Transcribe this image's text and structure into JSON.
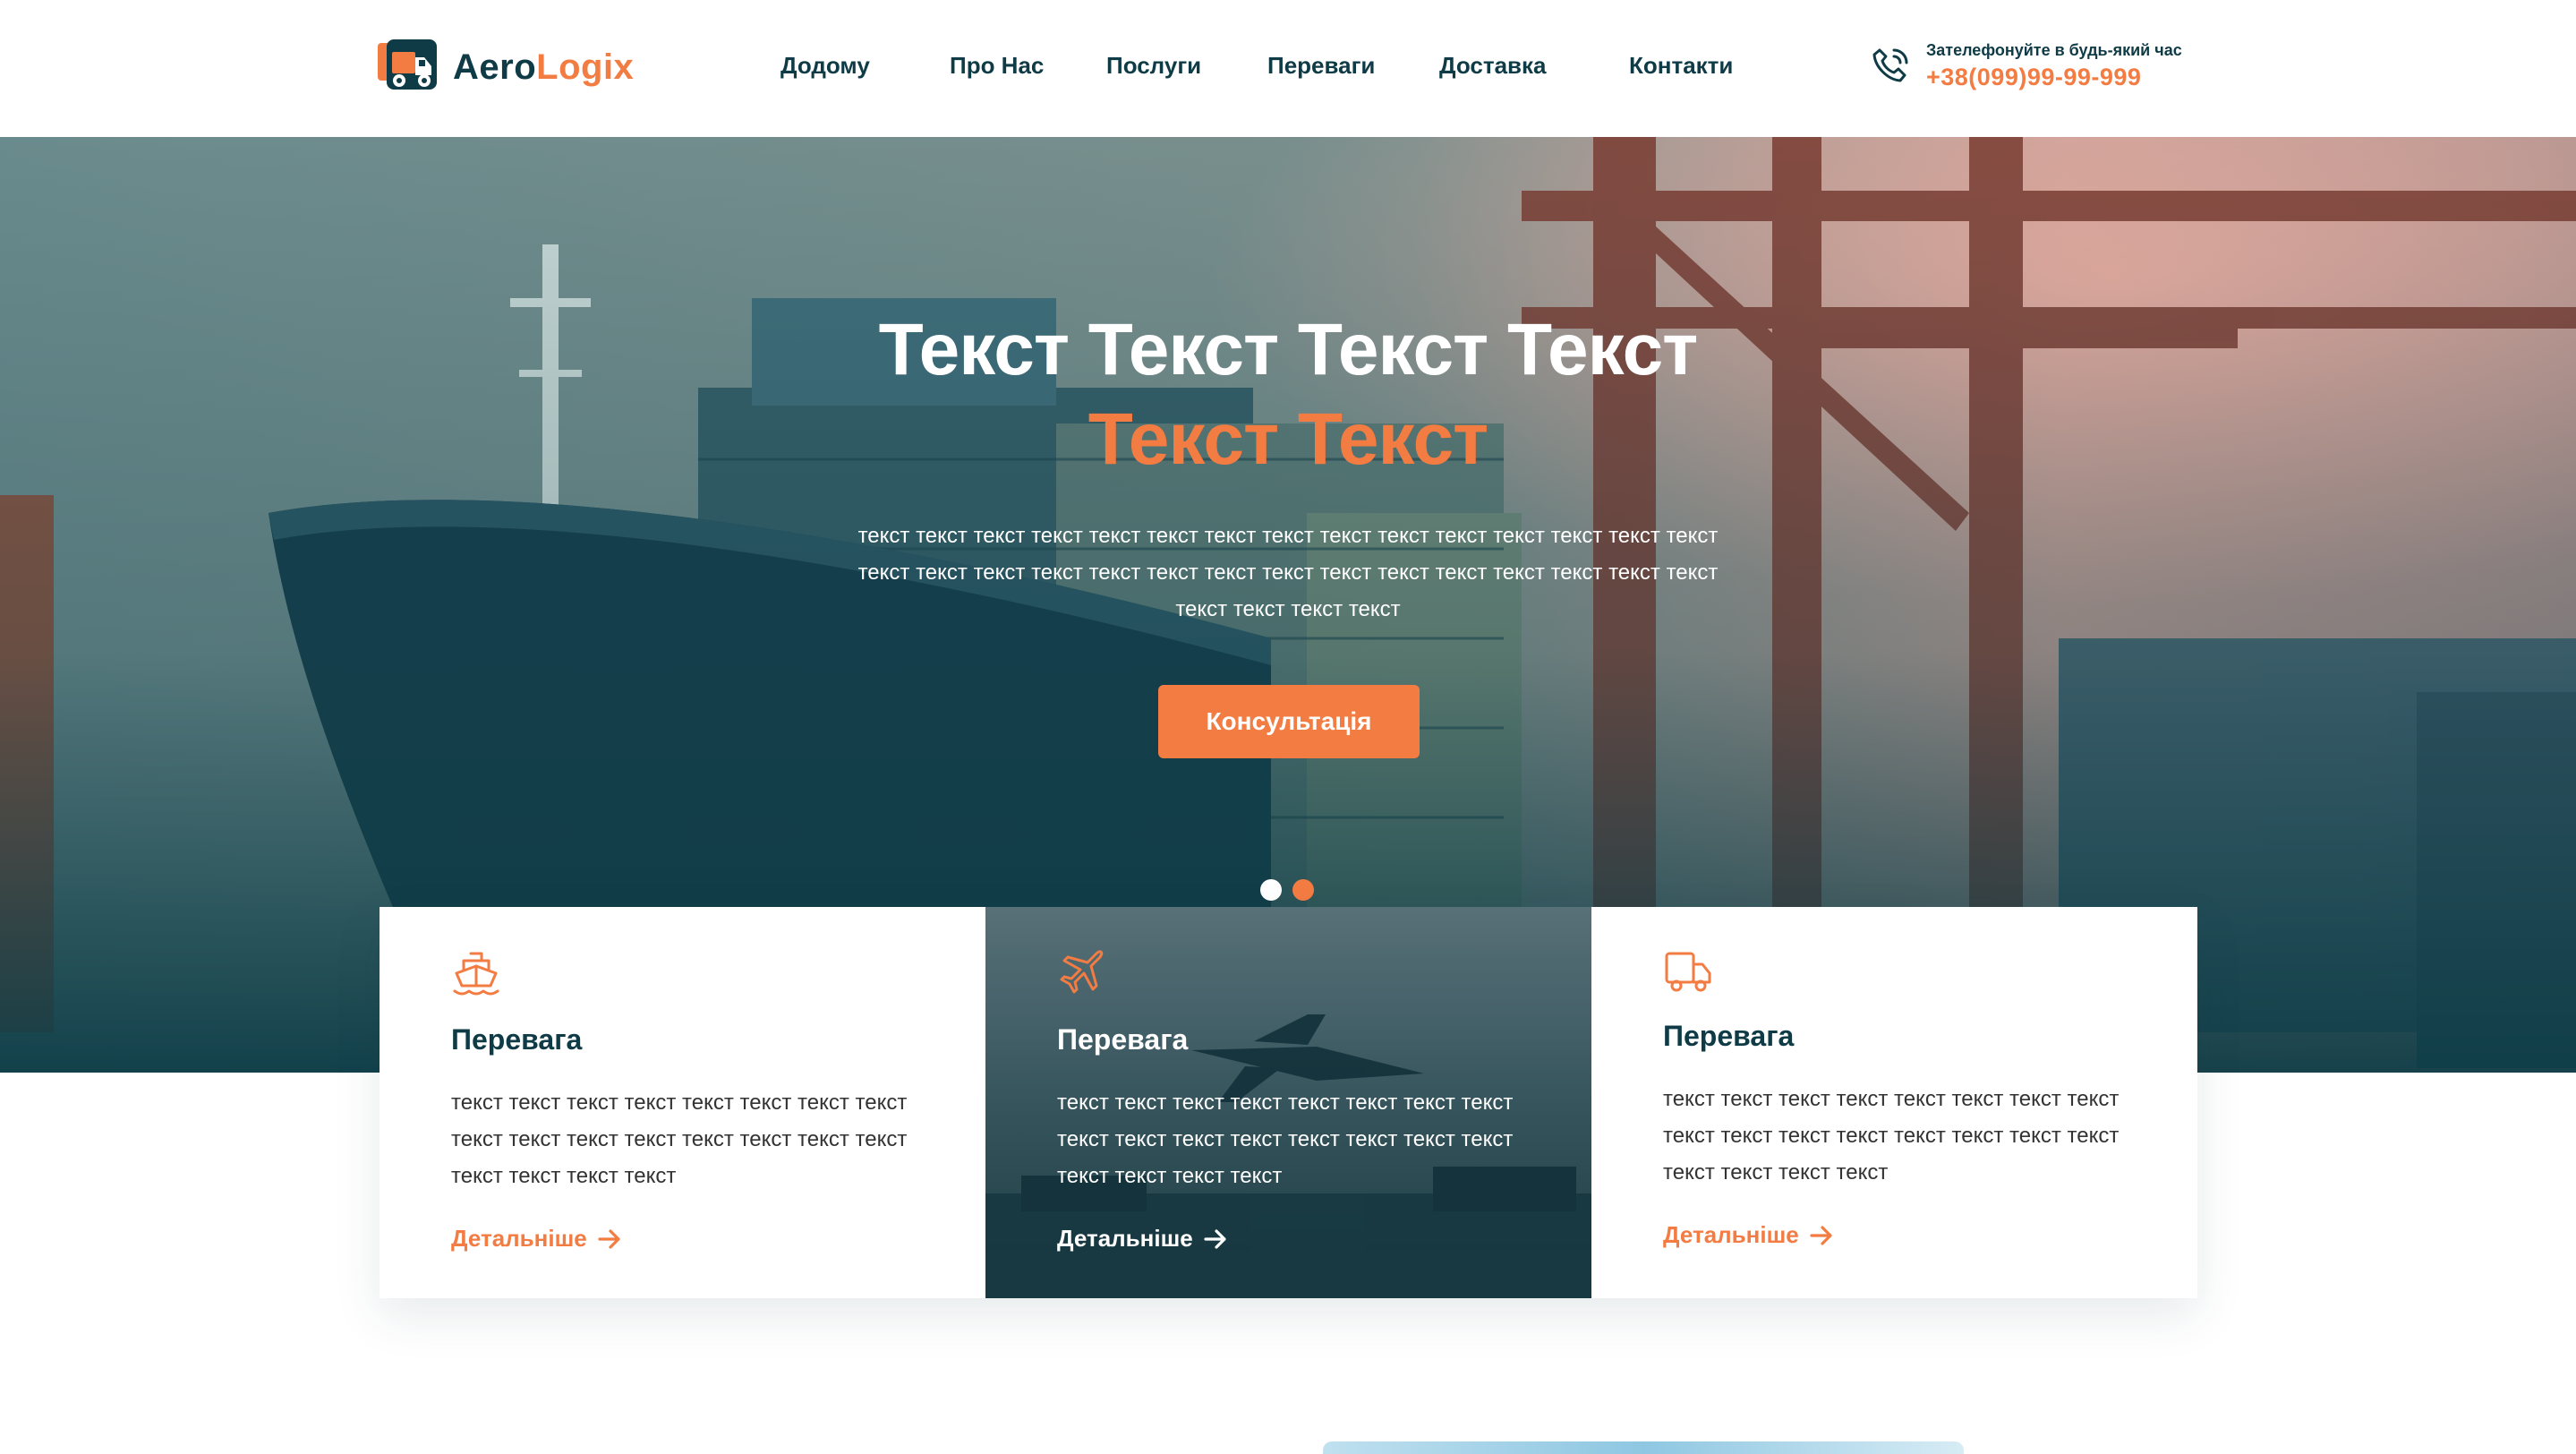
{
  "brand": {
    "name_part1": "Aero",
    "name_part2": "Logix",
    "accent": "#f37c43",
    "primary": "#0f3b46"
  },
  "nav": {
    "items": [
      {
        "label": "Додому"
      },
      {
        "label": "Про Нас"
      },
      {
        "label": "Послуги"
      },
      {
        "label": "Переваги"
      },
      {
        "label": "Доставка"
      },
      {
        "label": "Контакти"
      }
    ]
  },
  "contact": {
    "caption": "Зателефонуйте в будь-який час",
    "phone": "+38(099)99-99-999",
    "icon": "phone-icon"
  },
  "hero": {
    "title_line1": "Текст Текст Текст Текст",
    "title_line2": "Текст Текст",
    "text": "текст текст текст текст текст текст текст текст текст текст текст текст текст текст текст текст текст текст текст текст текст текст текст текст текст текст текст текст текст текст текст текст текст текст",
    "button": "Консультація",
    "slides": 2,
    "active_slide": 2
  },
  "cards": [
    {
      "icon": "ship-icon",
      "title": "Перевага",
      "text": "текст текст текст текст текст текст текст текст текст текст текст текст текст текст текст текст текст текст текст текст",
      "link": "Детальніше"
    },
    {
      "icon": "airplane-icon",
      "title": "Перевага",
      "text": "текст текст текст текст текст текст текст текст текст текст текст текст текст текст текст текст текст текст текст текст",
      "link": "Детальніше"
    },
    {
      "icon": "truck-icon",
      "title": "Перевага",
      "text": "текст текст текст текст текст текст текст текст текст текст текст текст текст текст текст текст текст текст текст текст",
      "link": "Детальніше"
    }
  ]
}
